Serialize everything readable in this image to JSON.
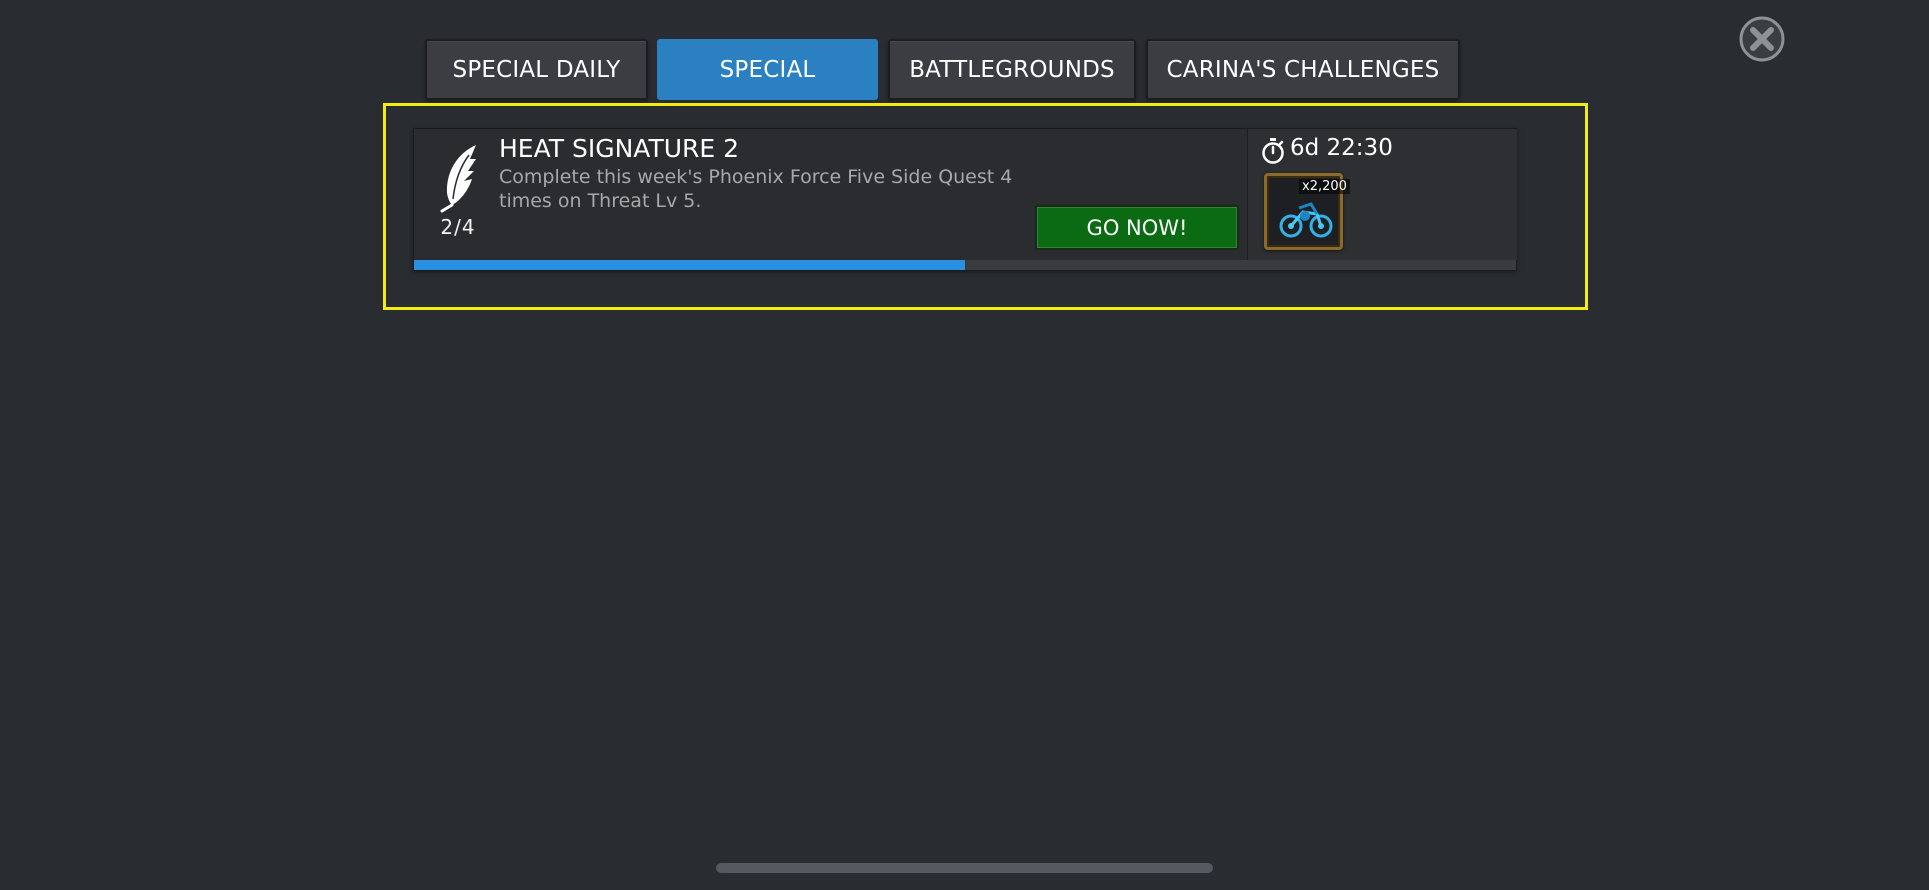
{
  "tabs": [
    {
      "label": "SPECIAL DAILY",
      "active": false
    },
    {
      "label": "SPECIAL",
      "active": true
    },
    {
      "label": "BATTLEGROUNDS",
      "active": false
    },
    {
      "label": "CARINA'S CHALLENGES",
      "active": false
    }
  ],
  "close_icon": "close-circle-icon",
  "quest": {
    "icon": "phoenix-feather-icon",
    "title": "HEAT SIGNATURE 2",
    "description": "Complete this week's Phoenix Force Five Side Quest 4 times on Threat Lv 5.",
    "progress_text": "2/4",
    "progress_fraction": 0.5,
    "go_button_label": "GO NOW!",
    "timer_icon": "stopwatch-icon",
    "timer_text": "6d 22:30",
    "reward": {
      "icon": "blue-orb-bike-icon",
      "quantity": "x2,200"
    }
  },
  "colors": {
    "background": "#292c31",
    "tab_active": "#2a80c0",
    "highlight_border": "#f2ec10",
    "progress_fill": "#2a8fe0",
    "go_button": "#0b6b12"
  }
}
